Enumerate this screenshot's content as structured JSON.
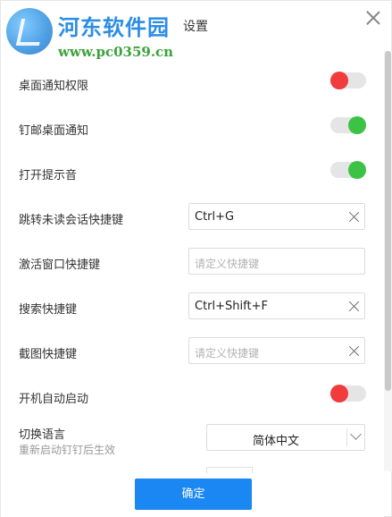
{
  "watermark": {
    "title": "河东软件园",
    "url": "www.pc0359.cn"
  },
  "window": {
    "title": "设置"
  },
  "settings": [
    {
      "label": "桌面通知权限",
      "toggle": "off"
    },
    {
      "label": "钉邮桌面通知",
      "toggle": "on"
    },
    {
      "label": "打开提示音",
      "toggle": "on"
    },
    {
      "label": "跳转未读会话快捷键",
      "value": "Ctrl+G",
      "placeholder": ""
    },
    {
      "label": "激活窗口快捷键",
      "value": "",
      "placeholder": "请定义快捷键"
    },
    {
      "label": "搜索快捷键",
      "value": "Ctrl+Shift+F",
      "placeholder": ""
    },
    {
      "label": "截图快捷键",
      "value": "",
      "placeholder": "请定义快捷键"
    },
    {
      "label": "开机自动启动",
      "toggle": "off"
    }
  ],
  "language": {
    "label": "切换语言",
    "note": "重新启动钉钉后生效",
    "selected": "简体中文"
  },
  "footer": {
    "ok_label": "确定"
  },
  "colors": {
    "toggle_on": "#3cc346",
    "toggle_off": "#f03c3c",
    "primary_button": "#1a87f2"
  }
}
